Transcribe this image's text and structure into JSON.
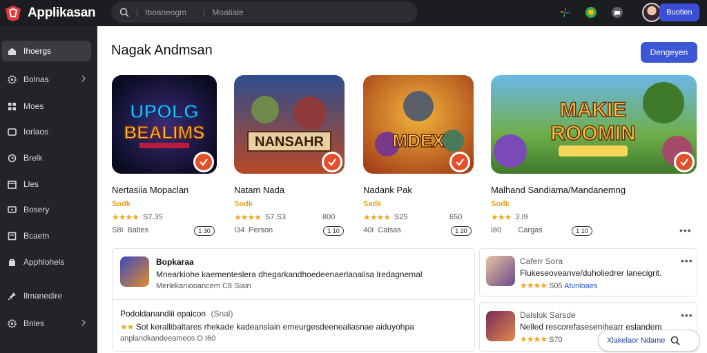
{
  "app": {
    "name": "Applikasan",
    "accent": "#3b57d6"
  },
  "search": {
    "left_text": "Iboaneogm",
    "right_text": "Moatiale"
  },
  "header": {
    "user_button": "Buotien"
  },
  "sidebar": {
    "items": [
      {
        "label": "Ihoergs",
        "icon": "home-icon",
        "active": true
      },
      {
        "label": "Bolnas",
        "icon": "gear-icon",
        "chevron": true
      },
      {
        "label": "Moes",
        "icon": "grid-icon"
      },
      {
        "label": "Iorlaos",
        "icon": "window-icon"
      },
      {
        "label": "Brelk",
        "icon": "clock-icon"
      },
      {
        "label": "Lles",
        "icon": "calendar-icon"
      },
      {
        "label": "Bosery",
        "icon": "monitor-icon"
      },
      {
        "label": "Bcaetn",
        "icon": "box-icon"
      },
      {
        "label": "Apphlohels",
        "icon": "bag-icon"
      },
      {
        "label": "Ilmanedire",
        "icon": "pin-icon"
      },
      {
        "label": "Bnles",
        "icon": "settings-icon",
        "chevron": true
      }
    ]
  },
  "main": {
    "title": "Nagak Andmsan",
    "primary_button": "Dengeyen",
    "featured": [
      {
        "name": "Nertasiia Mopaclan",
        "category": "Sodk",
        "stars": "★★★★",
        "rating": "S7.35",
        "count": "S8I",
        "extra": "Baltes",
        "pill": "1 30",
        "ext": "",
        "art_text": "UPOLG BEALIMS"
      },
      {
        "name": "Natam Nada",
        "category": "Sodk",
        "stars": "★★★★",
        "rating": "S7.S3",
        "count": "I34",
        "extra": "Person",
        "pill": "1 10",
        "ext": "800",
        "art_text": "NANSAHR"
      },
      {
        "name": "Nadank Pak",
        "category": "Sadk",
        "stars": "★★★★",
        "rating": "S25",
        "count": "40I",
        "extra": "Calsas",
        "pill": "1 20",
        "ext": "650",
        "art_text": "MDEX"
      },
      {
        "name": "Malhand Sandiama/Mandanemng",
        "category": "Sodk",
        "stars": "★★★",
        "rating": "3.I9",
        "count": "I80",
        "extra": "Cargas",
        "pill": "1 10",
        "ext": "",
        "art_text": "MAKIE ROOMIN"
      }
    ],
    "list_left": [
      {
        "title": "Bopkaraa",
        "desc": "Mnearkiohe kaementeslera dhegarkandhoedeenaerlanalisa lredagnemal",
        "sub": "Merlekaniooancem C8 Siain"
      },
      {
        "title": "Podoldanandiii epaicon",
        "title_suffix": "(Snal)",
        "desc": "Sot kerallibaltares rhekade kadeanslain emeurgesdeenealiasnae aiduyohpa",
        "stars": "★★",
        "sub": "anplandkandeeameos O I60"
      }
    ],
    "list_right": [
      {
        "title": "Caferr Sora",
        "desc": "Flukeseoveanve/duholiedrer lanecigrit.",
        "stars": "★★★★",
        "rating": "S05",
        "sub": "Atvnloaes"
      },
      {
        "title": "Dalslok Sarsde",
        "desc": "Nelled rescorefasesenihearr eslandem",
        "stars": "★★★★",
        "rating": "S70"
      }
    ],
    "bottom_search": "Xlakelaor Ndame"
  }
}
